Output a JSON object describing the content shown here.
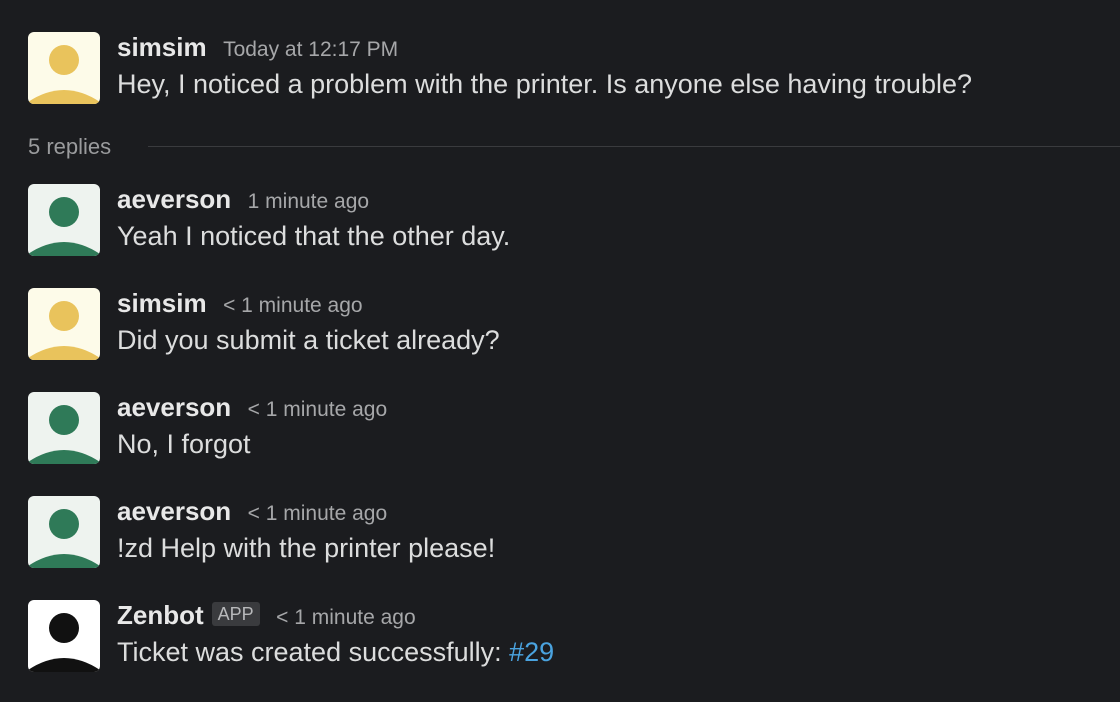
{
  "parent": {
    "author": "simsim",
    "timestamp": "Today at 12:17 PM",
    "text": "Hey, I noticed a problem with the printer. Is anyone else having trouble?",
    "avatar": {
      "icon": "user-avatar-icon",
      "bg": "#fdfbe9",
      "fg": "#e9c35c"
    }
  },
  "replies_label": "5 replies",
  "replies": [
    {
      "author": "aeverson",
      "timestamp": "1 minute ago",
      "text": "Yeah I noticed that the other day.",
      "avatar": {
        "icon": "user-avatar-icon",
        "bg": "#eef3ef",
        "fg": "#2f7a58"
      }
    },
    {
      "author": "simsim",
      "timestamp": "< 1 minute ago",
      "text": "Did you submit a ticket already?",
      "avatar": {
        "icon": "user-avatar-icon",
        "bg": "#fdfbe9",
        "fg": "#e9c35c"
      }
    },
    {
      "author": "aeverson",
      "timestamp": "< 1 minute ago",
      "text": "No, I forgot",
      "avatar": {
        "icon": "user-avatar-icon",
        "bg": "#eef3ef",
        "fg": "#2f7a58"
      }
    },
    {
      "author": "aeverson",
      "timestamp": "< 1 minute ago",
      "text": "!zd Help with the printer please!",
      "avatar": {
        "icon": "user-avatar-icon",
        "bg": "#eef3ef",
        "fg": "#2f7a58"
      }
    },
    {
      "author": "Zenbot",
      "badge": "APP",
      "timestamp": "< 1 minute ago",
      "text": "Ticket was created successfully: ",
      "link": "#29",
      "avatar": {
        "icon": "bot-avatar-icon",
        "bg": "#ffffff",
        "fg": "#111111"
      }
    }
  ],
  "colors": {
    "background": "#1b1c1f",
    "link": "#4aa3df"
  }
}
